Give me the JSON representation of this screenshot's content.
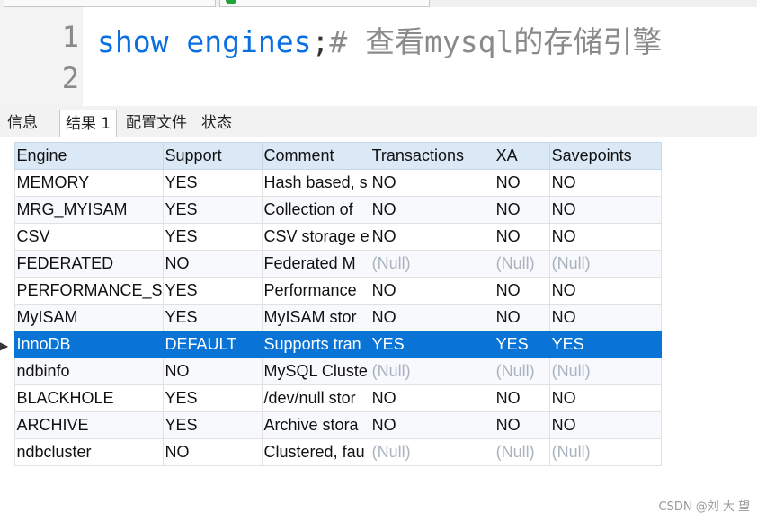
{
  "editor": {
    "line_numbers": [
      "1",
      "2"
    ],
    "code": {
      "keyword1": "show",
      "keyword2": "engines",
      "punct": ";",
      "comment": "# 查看mysql的存储引擎"
    }
  },
  "result_tabs": [
    {
      "label": "信息",
      "active": false
    },
    {
      "label": "结果 1",
      "active": true
    },
    {
      "label": "配置文件",
      "active": false
    },
    {
      "label": "状态",
      "active": false
    }
  ],
  "grid": {
    "columns": [
      "Engine",
      "Support",
      "Comment",
      "Transactions",
      "XA",
      "Savepoints"
    ],
    "rows": [
      {
        "engine": "MEMORY",
        "support": "YES",
        "comment": "Hash based, s",
        "transactions": "NO",
        "xa": "NO",
        "savepoints": "NO"
      },
      {
        "engine": "MRG_MYISAM",
        "support": "YES",
        "comment": "Collection of",
        "transactions": "NO",
        "xa": "NO",
        "savepoints": "NO"
      },
      {
        "engine": "CSV",
        "support": "YES",
        "comment": "CSV storage e",
        "transactions": "NO",
        "xa": "NO",
        "savepoints": "NO"
      },
      {
        "engine": "FEDERATED",
        "support": "NO",
        "comment": "Federated M",
        "transactions": "(Null)",
        "xa": "(Null)",
        "savepoints": "(Null)"
      },
      {
        "engine": "PERFORMANCE_S",
        "support": "YES",
        "comment": "Performance",
        "transactions": "NO",
        "xa": "NO",
        "savepoints": "NO"
      },
      {
        "engine": "MyISAM",
        "support": "YES",
        "comment": "MyISAM stor",
        "transactions": "NO",
        "xa": "NO",
        "savepoints": "NO"
      },
      {
        "engine": "InnoDB",
        "support": "DEFAULT",
        "comment": "Supports tran",
        "transactions": "YES",
        "xa": "YES",
        "savepoints": "YES",
        "selected": true
      },
      {
        "engine": "ndbinfo",
        "support": "NO",
        "comment": "MySQL Cluste",
        "transactions": "(Null)",
        "xa": "(Null)",
        "savepoints": "(Null)"
      },
      {
        "engine": "BLACKHOLE",
        "support": "YES",
        "comment": "/dev/null stor",
        "transactions": "NO",
        "xa": "NO",
        "savepoints": "NO"
      },
      {
        "engine": "ARCHIVE",
        "support": "YES",
        "comment": "Archive stora",
        "transactions": "NO",
        "xa": "NO",
        "savepoints": "NO"
      },
      {
        "engine": "ndbcluster",
        "support": "NO",
        "comment": "Clustered, fau",
        "transactions": "(Null)",
        "xa": "(Null)",
        "savepoints": "(Null)"
      }
    ],
    "row_indicator_icon": "caret-right-icon"
  },
  "watermark": "CSDN @刘 大 望",
  "colors": {
    "keyword": "#0a6fe0",
    "selection": "#0a74d6",
    "header": "#dbe9f7",
    "null_text": "#a9b3c0"
  }
}
